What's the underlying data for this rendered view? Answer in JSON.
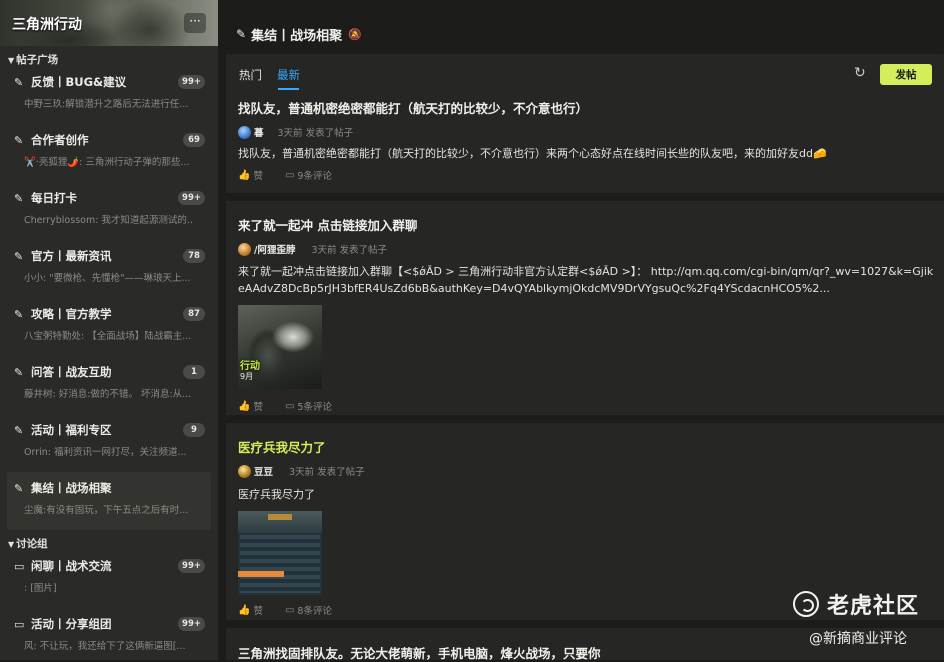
{
  "sidebar": {
    "title": "三角洲行动",
    "more": "···",
    "section1": "帖子广场",
    "items": [
      {
        "title": "反馈丨BUG&建议",
        "sub": "中野三玖:解锁潜升之路后无法进行任...",
        "badge": "99+"
      },
      {
        "title": "合作者创作",
        "sub": "✂️·亮狐狸🌶️: 三角洲行动子弹的那些...",
        "badge": "69"
      },
      {
        "title": "每日打卡",
        "sub": "Cherryblossom: 我才知道起源测试的...",
        "badge": "99+"
      },
      {
        "title": "官方丨最新资讯",
        "sub": "小小: \"要微枪、先懂枪\"——琳琅天上...",
        "badge": "78"
      },
      {
        "title": "攻略丨官方教学",
        "sub": "八宝粥特勤处: 【全面战场】陆战霸主...",
        "badge": "87"
      },
      {
        "title": "问答丨战友互助",
        "sub": "藤井树: 好消息:做的不错。 坏消息:从...",
        "badge": "1"
      },
      {
        "title": "活动丨福利专区",
        "sub": "Orrin: 福利资讯一网打尽，关注频道...",
        "badge": "9"
      },
      {
        "title": "集结丨战场相聚",
        "sub": "尘魔:有没有固玩，下午五点之后有时...",
        "badge": ""
      }
    ],
    "section2": "讨论组",
    "items2": [
      {
        "title": "闲聊丨战术交流",
        "sub": ": [图片]",
        "badge": "99+"
      },
      {
        "title": "活动丨分享组团",
        "sub": "风: 不让玩，我还给下了这俩新逼图[...",
        "badge": "99+"
      }
    ]
  },
  "header": {
    "title": "集结丨战场相聚"
  },
  "tabs": {
    "hot": "热门",
    "latest": "最新",
    "post_button": "发帖"
  },
  "posts": [
    {
      "title": "找队友，普通机密绝密都能打（航天打的比较少，不介意也行）",
      "author": "暮",
      "time": "3天前 发表了帖子",
      "body": "找队友，普通机密绝密都能打（航天打的比较少，不介意也行）来两个心态好点在线时间长些的队友吧，来的加好友dd🧀",
      "likes": "赞",
      "comments": "9条评论"
    },
    {
      "title": "来了就一起冲 点击链接加入群聊",
      "author": "/阿狸歪脖",
      "time": "3天前 发表了帖子",
      "body": "来了就一起冲点击链接加入群聊【<$ǿĀD > 三角洲行动非官方认定群<$ǿĀD >】： http://qm.qq.com/cgi-bin/qm/qr?_wv=1027&k=GjikeAAdvZ8DcBp5rJH3bfER4UsZd6bB&authKey=D4vQYAblkymjOkdcMV9DrVYgsuQc%2Fq4YScdacnHCO5%2...",
      "image_text": "行动",
      "image_sub": "9月",
      "likes": "赞",
      "comments": "5条评论"
    },
    {
      "title": "医疗兵我尽力了",
      "author": "豆豆",
      "time": "3天前 发表了帖子",
      "body": "医疗兵我尽力了",
      "likes": "赞",
      "comments": "8条评论"
    },
    {
      "title": "三角洲找固排队友。无论大佬萌新，手机电脑，烽火战场，只要你"
    }
  ],
  "watermark": {
    "logo": "老虎社区",
    "sub": "@新摘商业评论"
  },
  "colors": {
    "accent": "#d2ee5a",
    "tab_active": "#3aa8ff",
    "bg": "#1c1d1a",
    "card": "#262724"
  }
}
